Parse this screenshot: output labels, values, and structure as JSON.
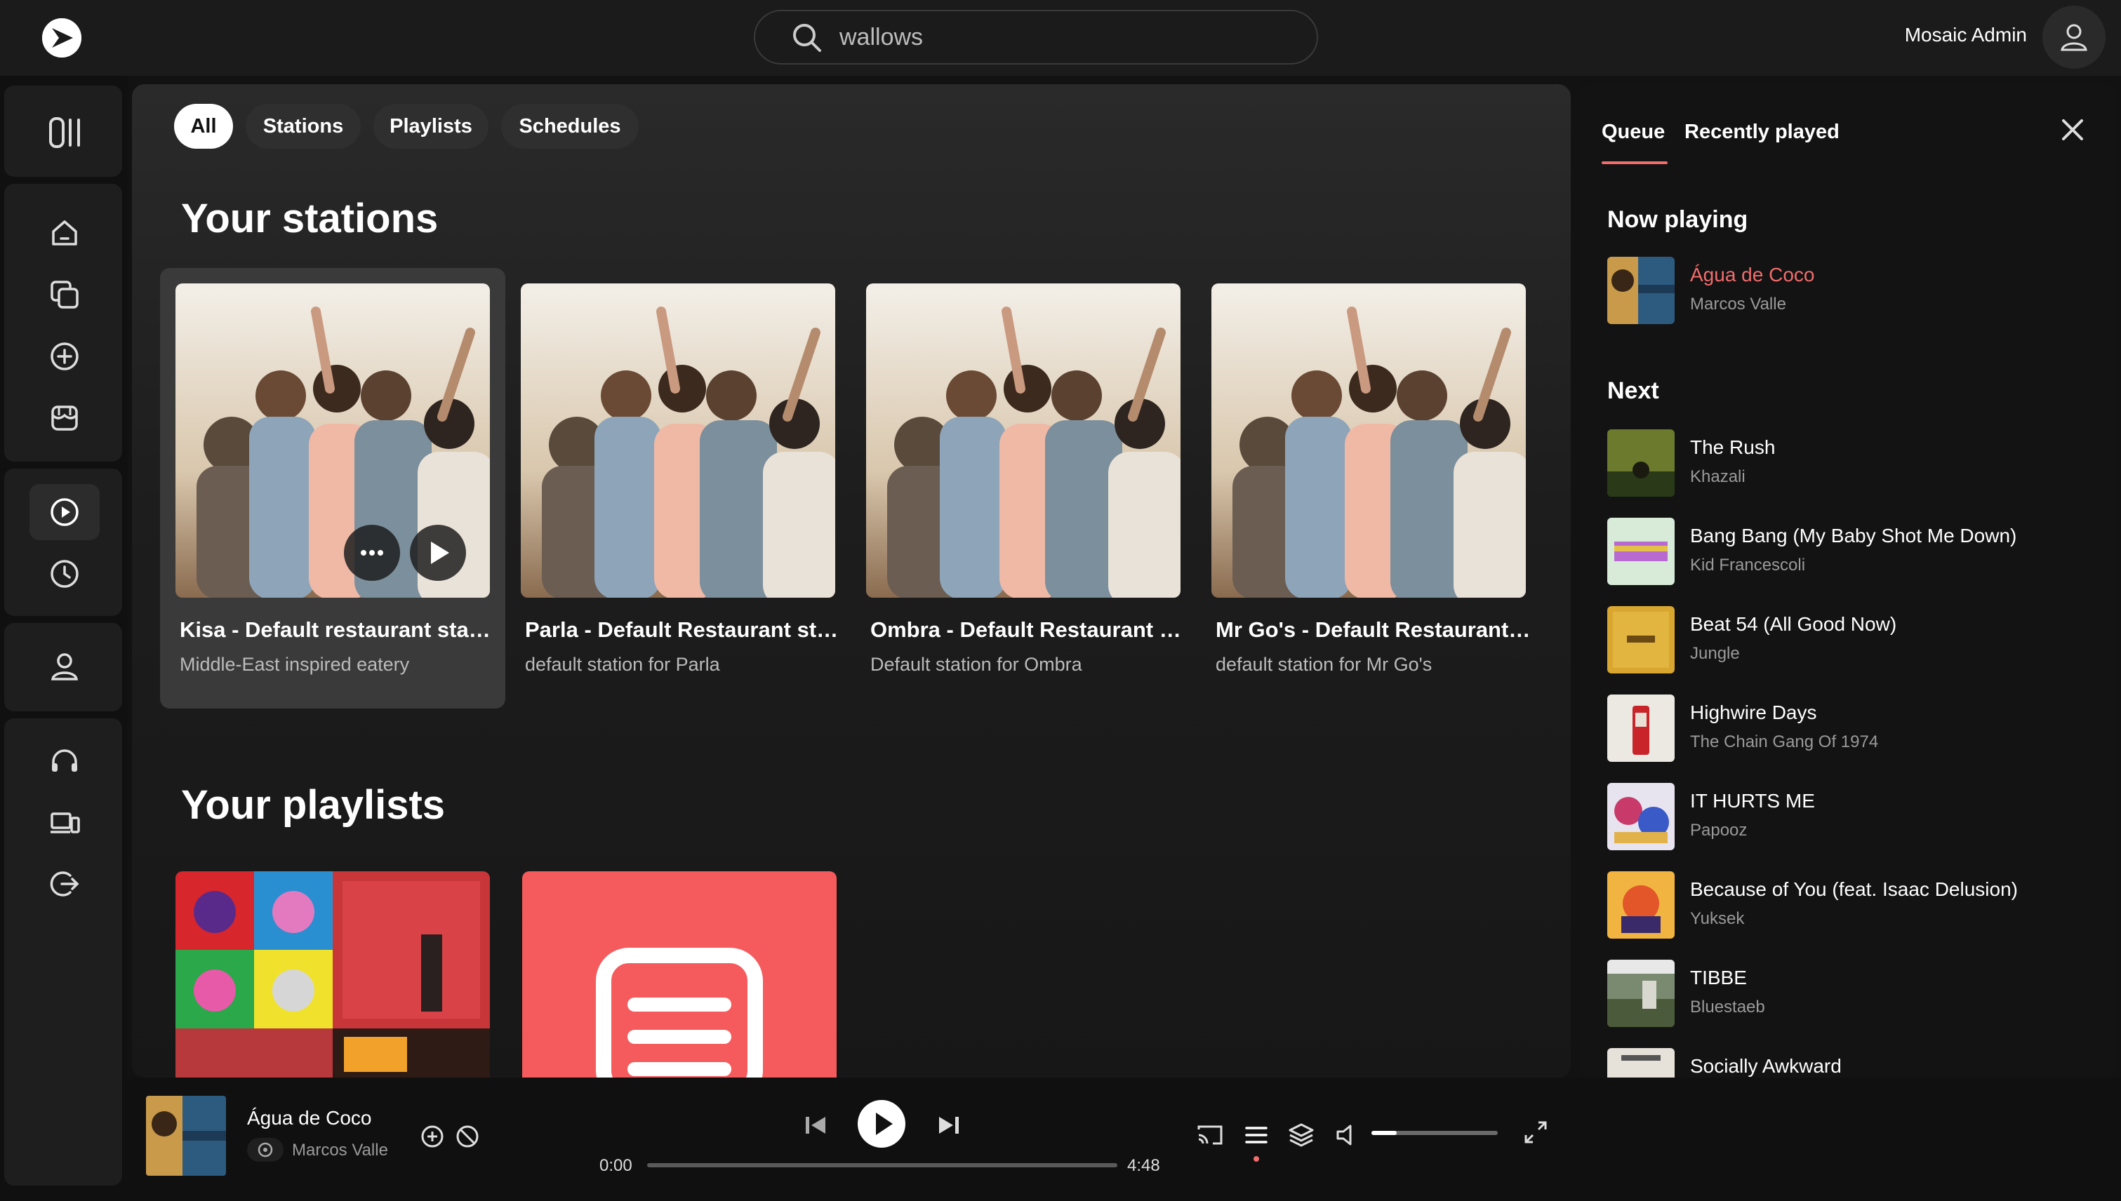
{
  "app": {
    "accent_color": "#f26c6c"
  },
  "search": {
    "value": "wallows"
  },
  "user": {
    "name": "Mosaic Admin"
  },
  "sidebar": {
    "items": [
      {
        "icon": "library-icon"
      },
      {
        "icon": "home-icon"
      },
      {
        "icon": "collections-icon"
      },
      {
        "icon": "add-circle-icon"
      },
      {
        "icon": "store-icon"
      },
      {
        "icon": "play-circle-icon",
        "active": true
      },
      {
        "icon": "clock-icon"
      },
      {
        "icon": "user-icon"
      },
      {
        "icon": "headset-icon"
      },
      {
        "icon": "devices-icon"
      },
      {
        "icon": "logout-icon"
      }
    ]
  },
  "filters": {
    "chips": [
      "All",
      "Stations",
      "Playlists",
      "Schedules"
    ],
    "selected": "All"
  },
  "stations": {
    "title": "Your stations",
    "items": [
      {
        "name": "Kisa - Default restaurant station",
        "description": "Middle-East inspired eatery"
      },
      {
        "name": "Parla - Default Restaurant station",
        "description": "default station for Parla"
      },
      {
        "name": "Ombra - Default Restaurant station",
        "description": "Default station for Ombra"
      },
      {
        "name": "Mr Go's - Default Restaurant station",
        "description": "default station for Mr Go's"
      }
    ]
  },
  "playlists": {
    "title": "Your playlists"
  },
  "queue_panel": {
    "tabs": [
      "Queue",
      "Recently played"
    ],
    "selected_tab": "Queue",
    "now_playing_heading": "Now playing",
    "next_heading": "Next",
    "now_playing": {
      "title": "Água de Coco",
      "artist": "Marcos Valle"
    },
    "next": [
      {
        "title": "The Rush",
        "artist": "Khazali"
      },
      {
        "title": "Bang Bang (My Baby Shot Me Down)",
        "artist": "Kid Francescoli"
      },
      {
        "title": "Beat 54 (All Good Now)",
        "artist": "Jungle"
      },
      {
        "title": "Highwire Days",
        "artist": "The Chain Gang Of 1974"
      },
      {
        "title": "IT HURTS ME",
        "artist": "Papooz"
      },
      {
        "title": "Because of You (feat. Isaac Delusion)",
        "artist": "Yuksek"
      },
      {
        "title": "TIBBE",
        "artist": "Bluestaeb"
      },
      {
        "title": "Socially Awkward",
        "artist": ""
      }
    ]
  },
  "player": {
    "title": "Água de Coco",
    "artist": "Marcos Valle",
    "elapsed": "0:00",
    "duration": "4:48",
    "progress": 0.0,
    "volume": 0.2
  }
}
